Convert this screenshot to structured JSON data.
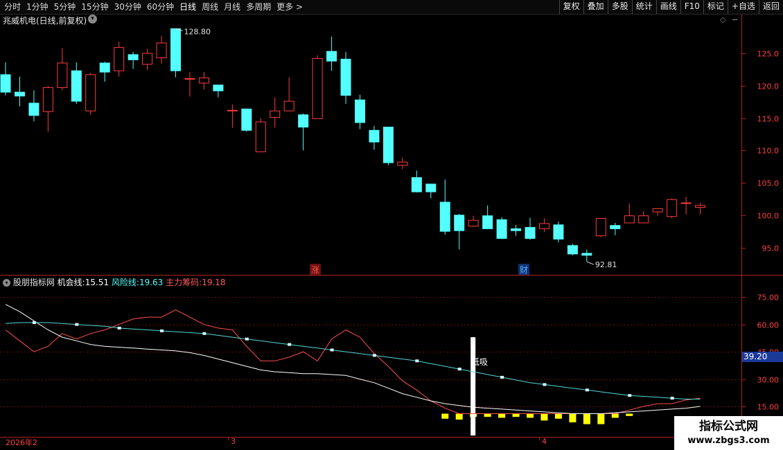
{
  "toolbar": {
    "periods": [
      "分时",
      "1分钟",
      "5分钟",
      "15分钟",
      "30分钟",
      "60分钟",
      "日线",
      "周线",
      "月线",
      "多周期",
      "更多"
    ],
    "active": "日线",
    "more_arrow": ">",
    "buttons": [
      "复权",
      "叠加",
      "多股",
      "统计",
      "画线",
      "F10",
      "标记",
      "+自选",
      "返回"
    ]
  },
  "main": {
    "title": "兆威机电(日线,前复权)",
    "high_label": "128.80",
    "low_label": "92.81",
    "marker_zhang": "涨",
    "marker_cai": "财",
    "y_ticks": [
      "125.0",
      "120.0",
      "115.0",
      "110.0",
      "105.0",
      "100.0",
      "95.0"
    ],
    "colors": {
      "up": "#ff3c3c",
      "down": "#54ffff"
    },
    "candles": [
      [
        121.7,
        119,
        118.5,
        123.6
      ],
      [
        119,
        118.4,
        116.8,
        121.4
      ],
      [
        117.3,
        115.4,
        114.5,
        119.3
      ],
      [
        116,
        119.7,
        112.9,
        120
      ],
      [
        119.7,
        123.5,
        119.3,
        125.8
      ],
      [
        122.3,
        117.6,
        117.2,
        123.6
      ],
      [
        116.1,
        121.7,
        115.5,
        122
      ],
      [
        123.5,
        122.1,
        120.6,
        123.7
      ],
      [
        122.3,
        125.9,
        121.4,
        126.8
      ],
      [
        124.8,
        124,
        122.6,
        125.2
      ],
      [
        123.3,
        125,
        122.4,
        125.7
      ],
      [
        124.3,
        126.6,
        123.4,
        127.7
      ],
      [
        128.8,
        122.3,
        121.3,
        128.8
      ],
      [
        121.1,
        121.1,
        118.3,
        122.1
      ],
      [
        120.4,
        121.2,
        119.4,
        122.1
      ],
      [
        120.1,
        119.2,
        118.2,
        120.1
      ],
      [
        116.2,
        116.2,
        113.5,
        117.1
      ],
      [
        116.4,
        113.1,
        112.9,
        116.4
      ],
      [
        109.8,
        114.4,
        109.7,
        115
      ],
      [
        115.1,
        116.1,
        113.5,
        118.2
      ],
      [
        116.1,
        117.6,
        116.6,
        121.3
      ],
      [
        115.5,
        113.6,
        110,
        115.7
      ],
      [
        114.9,
        124.2,
        114.9,
        124.7
      ],
      [
        125.3,
        123.8,
        122.3,
        127.6
      ],
      [
        124.1,
        118.5,
        117.2,
        125.2
      ],
      [
        117.8,
        114.3,
        113.3,
        118.6
      ],
      [
        113.1,
        111.3,
        110.1,
        113.8
      ],
      [
        113.6,
        108.1,
        107.7,
        113.6
      ],
      [
        107.7,
        108.2,
        107.1,
        108.9
      ],
      [
        105.8,
        103.6,
        103.5,
        106.9
      ],
      [
        104.8,
        103.6,
        102.6,
        104.8
      ],
      [
        102,
        97.5,
        97,
        105.5
      ],
      [
        100,
        97.6,
        94.7,
        100.2
      ],
      [
        98.3,
        99.2,
        98.2,
        99.9
      ],
      [
        99.9,
        97.9,
        97.9,
        101.5
      ],
      [
        99.3,
        96.4,
        96.4,
        99.7
      ],
      [
        97.9,
        97.6,
        96.8,
        98.5
      ],
      [
        98.1,
        96.4,
        96.2,
        99.6
      ],
      [
        97.9,
        98.7,
        97.4,
        99.5
      ],
      [
        98.5,
        96.3,
        95.8,
        99
      ],
      [
        95.3,
        94,
        93.8,
        95.6
      ],
      [
        94.1,
        93.8,
        92.8,
        94.7
      ],
      [
        96.8,
        99.5,
        96.6,
        99.5
      ],
      [
        98.4,
        97.9,
        96.9,
        98.8
      ],
      [
        98.8,
        99.9,
        99,
        101.8
      ],
      [
        98.8,
        99.9,
        98.8,
        100.6
      ],
      [
        100.5,
        101,
        99.9,
        101.1
      ],
      [
        99.8,
        102.4,
        99.5,
        102.6
      ],
      [
        101.8,
        101.9,
        100.1,
        102.8
      ],
      [
        101.2,
        101.5,
        100.1,
        101.9
      ]
    ]
  },
  "indicator": {
    "source": "股朋指标网",
    "line1_name": "机会线:",
    "line1_value": "15.51",
    "line2_name": "风险线:",
    "line2_value": "19.63",
    "line3_name": "主力筹码:",
    "line3_value": "19.18",
    "y_ticks": [
      "75.00",
      "60.00",
      "45.00",
      "30.00",
      "15.00"
    ],
    "current_value": "39.20",
    "annotation": "低吸",
    "series": {
      "white": [
        71,
        67,
        62,
        57,
        53,
        51,
        49,
        48,
        47.5,
        47,
        46.5,
        46,
        45.5,
        44.5,
        43,
        41,
        39,
        37,
        35,
        34,
        33.5,
        33,
        33,
        32.5,
        32,
        30,
        28,
        25,
        22,
        20,
        18,
        16.5,
        15.5,
        14.5,
        14,
        13.5,
        13,
        12.5,
        12,
        11.5,
        11,
        11,
        11,
        11.5,
        12,
        12.5,
        13,
        13.5,
        14,
        15
      ],
      "red": [
        57,
        51,
        45,
        48,
        55,
        52,
        55,
        57,
        60,
        63,
        64,
        64,
        68,
        64,
        60,
        58,
        57,
        48,
        40,
        40,
        42,
        45,
        40,
        52,
        57,
        53,
        44,
        37,
        29,
        24,
        18,
        14,
        11,
        11,
        11,
        11,
        11,
        11,
        11,
        11,
        11,
        11,
        11,
        11,
        13,
        15,
        16.5,
        16.5,
        18.5,
        19.5
      ],
      "cyan": [
        60.5,
        61,
        61,
        61,
        60.5,
        60,
        59.5,
        59,
        58,
        57.5,
        57,
        56.5,
        56,
        55.5,
        55,
        54,
        53,
        52,
        51,
        50,
        49,
        48,
        47,
        46,
        45,
        44,
        43,
        42,
        41,
        40,
        38.5,
        37,
        35.5,
        34,
        32.5,
        31,
        29.5,
        28,
        27,
        26,
        25,
        24,
        23,
        22,
        21,
        20.5,
        20,
        19.5,
        19,
        19
      ],
      "yellow_bars": [
        [
          31,
          2
        ],
        [
          32,
          2.5
        ],
        [
          33,
          1
        ],
        [
          34,
          1
        ],
        [
          35,
          1.5
        ],
        [
          36,
          1
        ],
        [
          37,
          1.5
        ],
        [
          38,
          3
        ],
        [
          39,
          2
        ],
        [
          40,
          4
        ],
        [
          41,
          5
        ],
        [
          42,
          5
        ],
        [
          43,
          1.5
        ],
        [
          44,
          0.5
        ]
      ]
    }
  },
  "time_axis": {
    "labels": [
      "2026年2",
      "3",
      "4"
    ]
  },
  "logo": {
    "name": "指标公式网",
    "url": "www.zbgs3.com"
  }
}
